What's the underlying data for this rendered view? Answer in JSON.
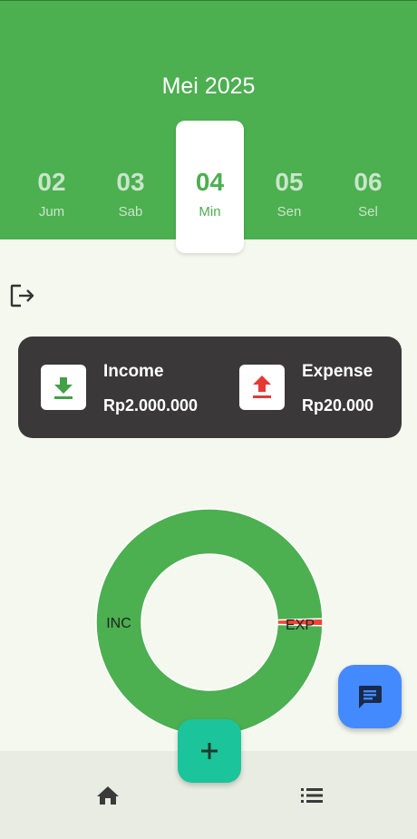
{
  "header": {
    "month": "Mei 2025",
    "dates": [
      {
        "num": "02",
        "day": "Jum",
        "selected": false
      },
      {
        "num": "03",
        "day": "Sab",
        "selected": false
      },
      {
        "num": "04",
        "day": "Min",
        "selected": true
      },
      {
        "num": "05",
        "day": "Sen",
        "selected": false
      },
      {
        "num": "06",
        "day": "Sel",
        "selected": false
      }
    ]
  },
  "icons": {
    "logout": "logout-icon",
    "income": "download-icon",
    "expense": "upload-icon",
    "chat": "chat-icon",
    "add": "plus-icon",
    "home": "home-icon",
    "list": "list-icon"
  },
  "summary": {
    "income_label": "Income",
    "income_value": "Rp2.000.000",
    "expense_label": "Expense",
    "expense_value": "Rp20.000"
  },
  "chart_data": {
    "type": "pie",
    "categories": [
      "INC",
      "EXP"
    ],
    "values": [
      2000000,
      20000
    ],
    "colors": [
      "#4caf50",
      "#f44336"
    ]
  },
  "colors": {
    "primary": "#4caf50",
    "card": "#3a3839",
    "income_icon": "#43a047",
    "expense_icon": "#e53935",
    "chat_fab": "#448aff",
    "add_fab": "#1bc49a"
  }
}
